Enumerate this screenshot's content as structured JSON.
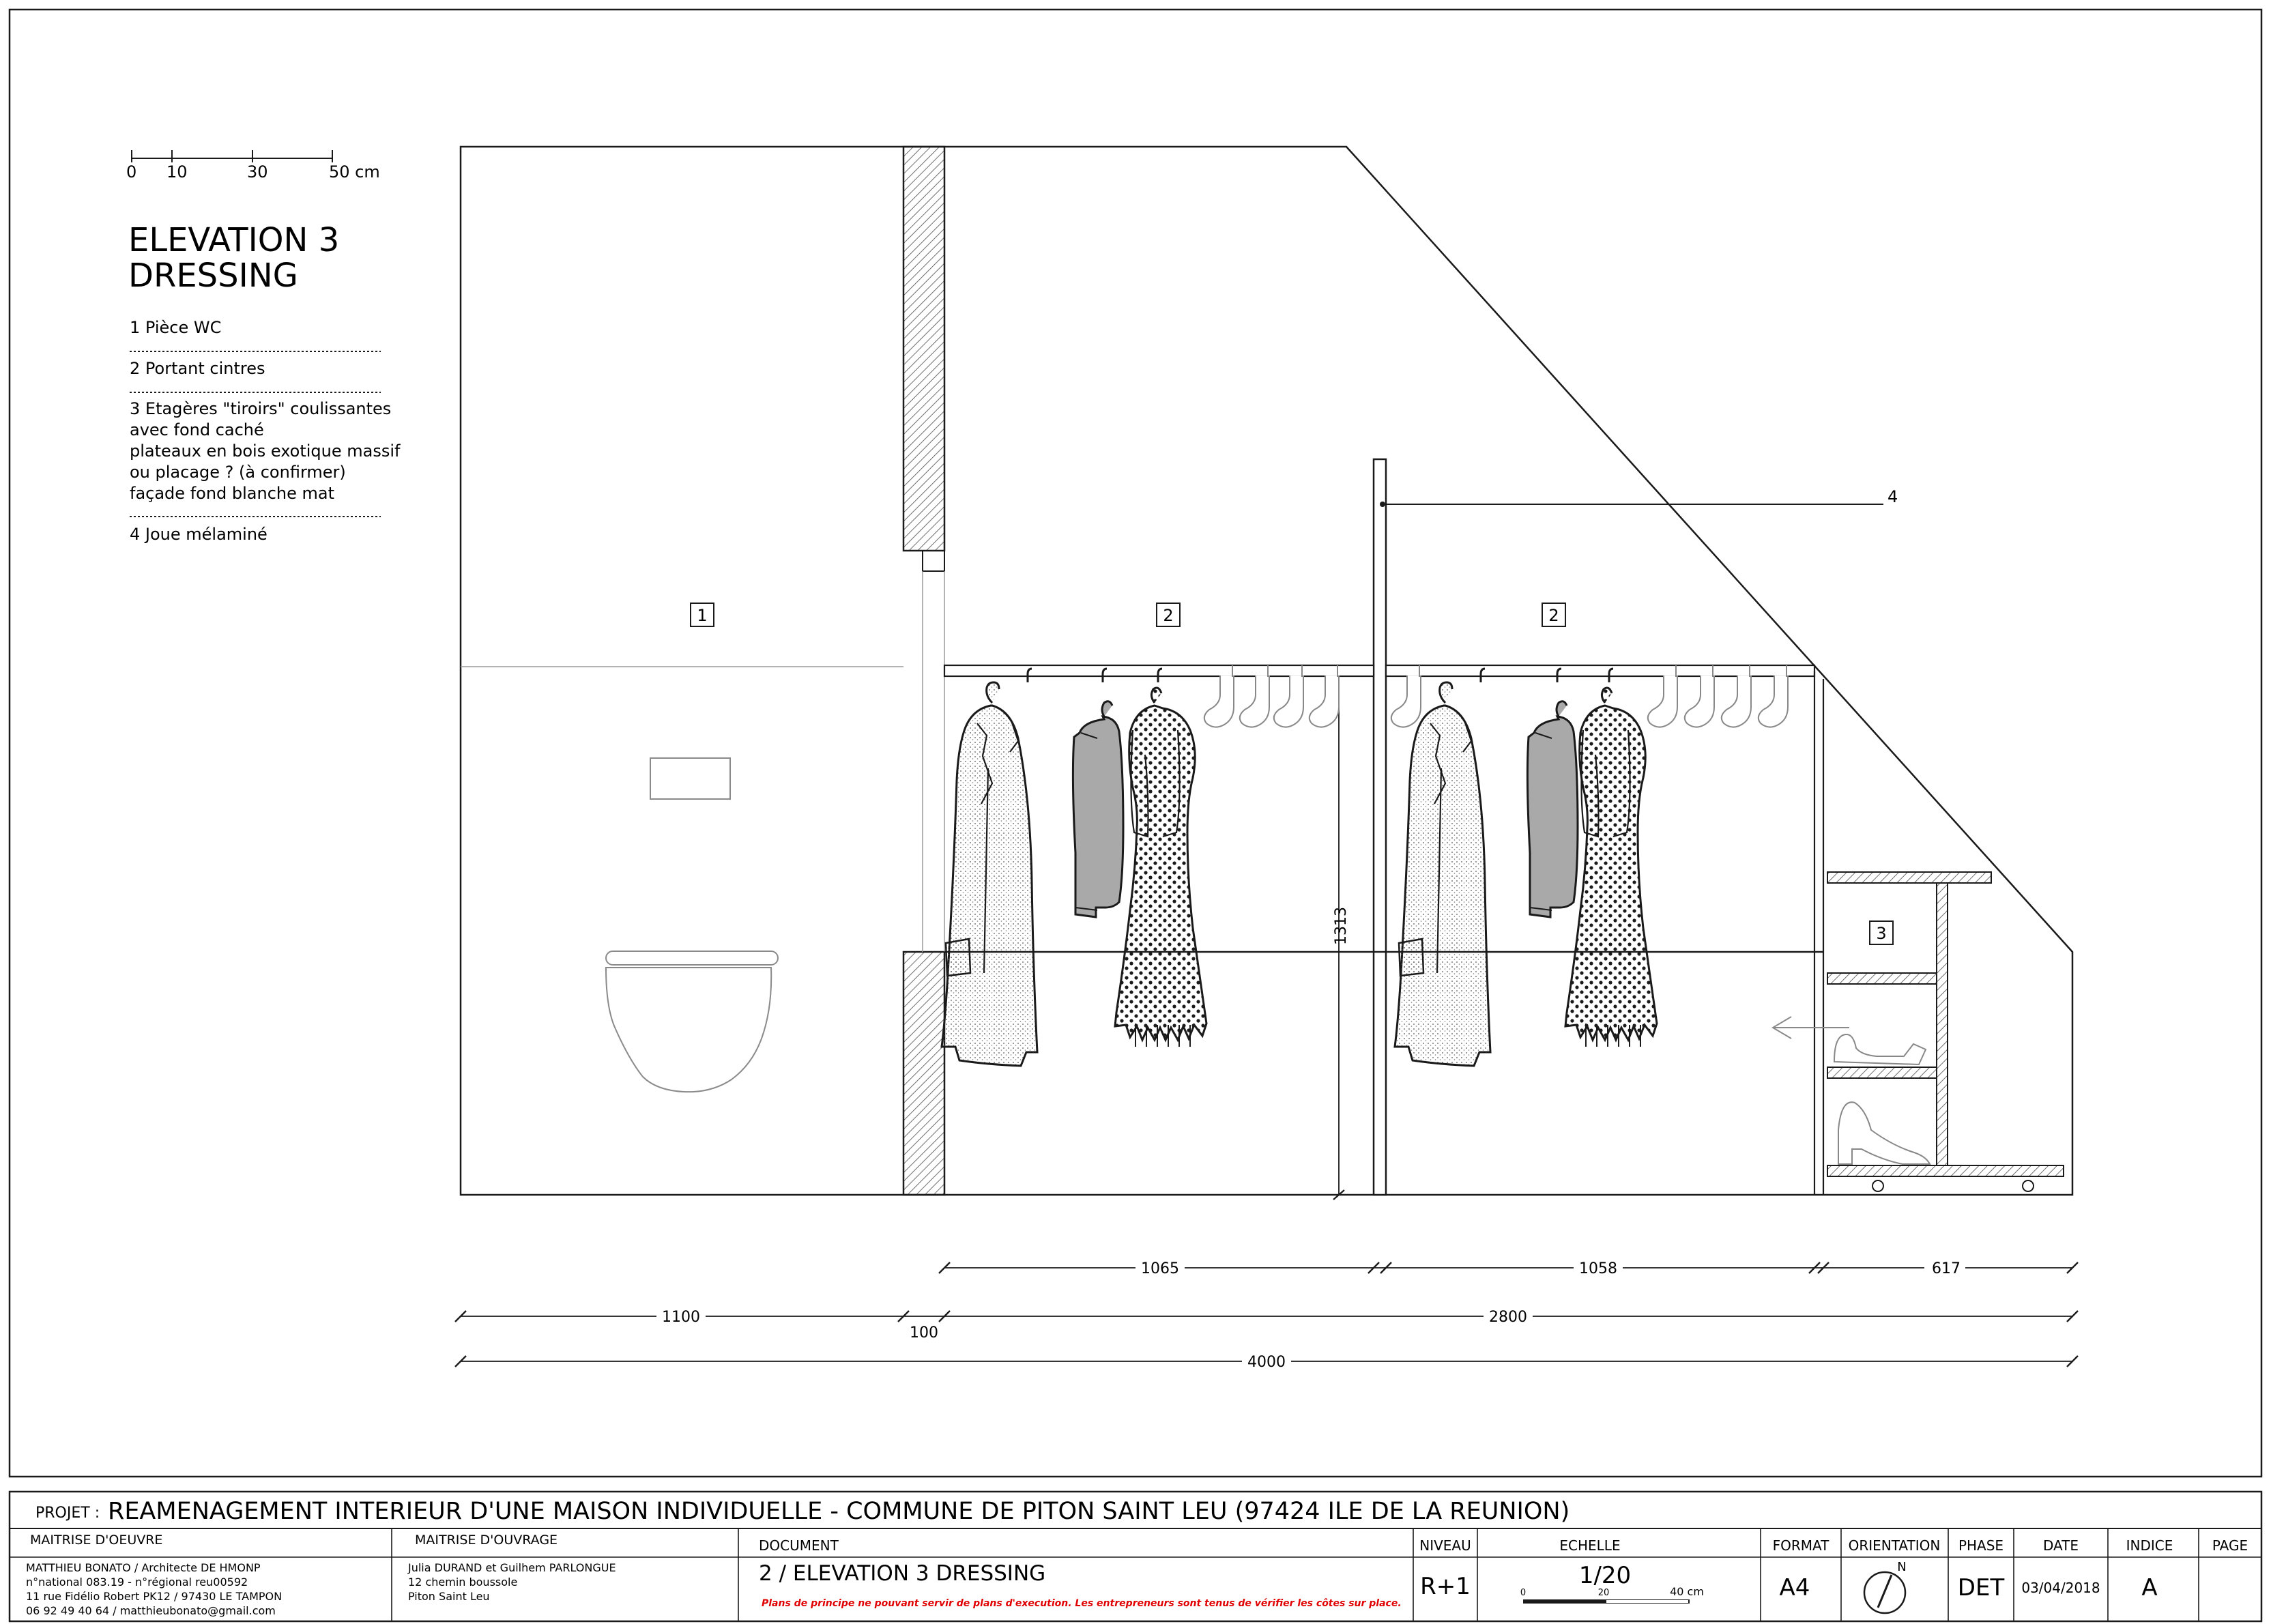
{
  "scale_bar": {
    "ticks": [
      "0",
      "10",
      "30",
      "50 cm"
    ]
  },
  "legend": {
    "title_line1": "ELEVATION 3",
    "title_line2": "DRESSING",
    "items": [
      {
        "lines": [
          "1 Pièce WC"
        ]
      },
      {
        "lines": [
          "2 Portant cintres"
        ]
      },
      {
        "lines": [
          "3 Etagères \"tiroirs\" coulissantes",
          "avec fond caché",
          "plateaux en bois exotique massif",
          "ou placage ? (à confirmer)",
          "façade fond blanche mat"
        ]
      },
      {
        "lines": [
          "4 Joue mélaminé"
        ]
      }
    ]
  },
  "tags": {
    "wc": "1",
    "rail_a": "2",
    "rail_b": "2",
    "shelves": "3",
    "side_panel": "4"
  },
  "dimensions": {
    "height_rail": "1313",
    "row1": [
      "1065",
      "1058",
      "617"
    ],
    "row2_left": "1100",
    "row2_wall": "100",
    "row2_right": "2800",
    "total": "4000"
  },
  "titleblock": {
    "projet_label": "PROJET :",
    "projet_value": "REAMENAGEMENT INTERIEUR D'UNE MAISON INDIVIDUELLE - COMMUNE DE PITON SAINT LEU (97424 ILE DE LA REUNION)",
    "moe_label": "MAITRISE D'OEUVRE",
    "moe_lines": [
      "MATTHIEU BONATO / Architecte DE HMONP",
      "n°national 083.19 - n°régional reu00592",
      "11 rue Fidélio Robert PK12 / 97430 LE TAMPON",
      "06 92 49 40 64 / matthieubonato@gmail.com"
    ],
    "mo_label": "MAITRISE D'OUVRAGE",
    "mo_lines": [
      "Julia DURAND et Guilhem PARLONGUE",
      "12 chemin boussole",
      "Piton Saint Leu"
    ],
    "document_label": "DOCUMENT",
    "document_value": "2 / ELEVATION 3 DRESSING",
    "warning": "Plans de principe ne pouvant servir de plans d'execution. Les entrepreneurs sont tenus de vérifier les côtes sur place.",
    "niveau_label": "NIVEAU",
    "niveau_value": "R+1",
    "echelle_label": "ECHELLE",
    "echelle_value": "1/20",
    "echelle_ticks": [
      "0",
      "20",
      "40 cm"
    ],
    "format_label": "FORMAT",
    "format_value": "A4",
    "orientation_label": "ORIENTATION",
    "orientation_north": "N",
    "phase_label": "PHASE",
    "phase_value": "DET",
    "date_label": "DATE",
    "date_value": "03/04/2018",
    "indice_label": "INDICE",
    "indice_value": "A",
    "page_label": "PAGE",
    "page_value": ""
  },
  "colors": {
    "ink": "#1a1a1a",
    "hatch": "#7a7a7a",
    "sweater": "#a9a9a9",
    "warning": "#e00000"
  }
}
